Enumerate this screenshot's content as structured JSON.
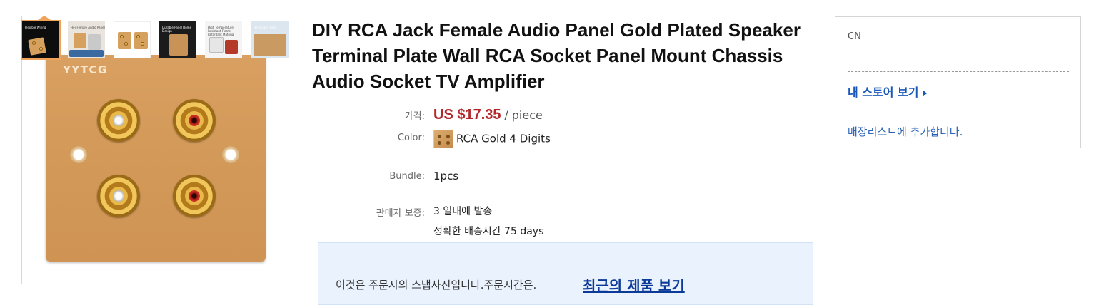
{
  "gallery": {
    "brand": "YYTCG",
    "thumbnails": [
      {
        "caption": "Flexible Wiring"
      },
      {
        "caption": "HiFi Female Audio Panel"
      },
      {
        "caption": ""
      },
      {
        "caption": "Durable Panel Dome Design"
      },
      {
        "caption": "High Temperature Resistant Flame Retardant Material"
      },
      {
        "caption": "HiFi Audio Panel"
      }
    ]
  },
  "product": {
    "title": "DIY RCA Jack Female Audio Panel Gold Plated Speaker Terminal Plate Wall RCA Socket Panel Mount Chassis Audio Socket TV Amplifier",
    "price_label": "가격:",
    "price_amount": "US $17.35",
    "price_unit": "/ piece",
    "color_label": "Color:",
    "color_value": "RCA Gold 4 Digits",
    "bundle_label": "Bundle:",
    "bundle_value": "1pcs",
    "guarantee_label": "판매자 보증:",
    "guarantee_ship": "3 일내에 발송",
    "guarantee_delivery": "정확한 배송시간 75 days"
  },
  "snapshot": {
    "text": "이것은 주문시의 스냅사진입니다.주문시간은.",
    "link": "최근의 제품 보기"
  },
  "store": {
    "country": "CN",
    "visit_store": "내 스토어 보기",
    "add_to_list": "매장리스트에 추가합니다."
  },
  "colors": {
    "price": "#b2282b",
    "link": "#1a58b8",
    "snapshot_bg": "#eaf2fd"
  }
}
